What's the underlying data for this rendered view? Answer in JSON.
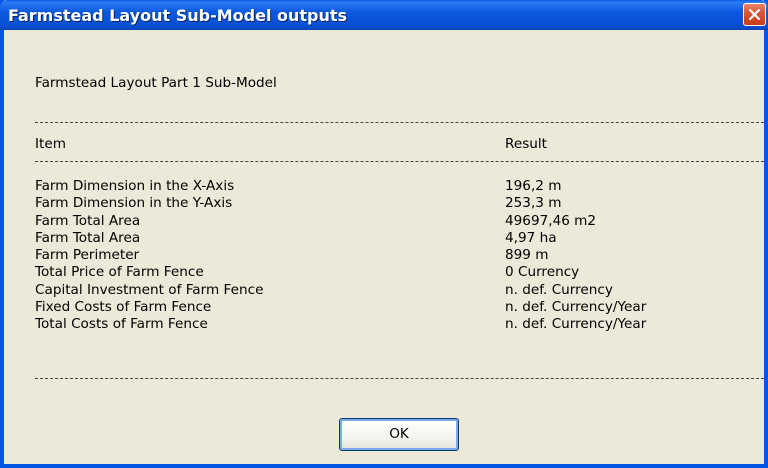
{
  "window": {
    "title": "Farmstead Layout Sub-Model outputs",
    "close_icon": "close-icon"
  },
  "content": {
    "subtitle": "Farmstead Layout Part 1 Sub-Model",
    "header": {
      "item": "Item",
      "result": "Result"
    },
    "rows": [
      {
        "item": "Farm Dimension in the X-Axis",
        "result": "196,2 m"
      },
      {
        "item": "Farm Dimension in the Y-Axis",
        "result": "253,3 m"
      },
      {
        "item": "Farm Total Area",
        "result": "49697,46 m2"
      },
      {
        "item": "Farm Total Area",
        "result": "4,97 ha"
      },
      {
        "item": "Farm Perimeter",
        "result": "899 m"
      },
      {
        "item": "Total Price of Farm Fence",
        "result": "0 Currency"
      },
      {
        "item": "Capital Investment of Farm Fence",
        "result": "n. def. Currency"
      },
      {
        "item": "Fixed Costs of Farm Fence",
        "result": "n. def. Currency/Year"
      },
      {
        "item": "Total Costs of Farm Fence",
        "result": "n. def. Currency/Year"
      }
    ]
  },
  "buttons": {
    "ok_label": "OK"
  },
  "colors": {
    "title_bar": "#0A4FD0",
    "window_border": "#0055E5",
    "dialog_bg": "#ECE9D8",
    "close_button": "#D9532E"
  }
}
